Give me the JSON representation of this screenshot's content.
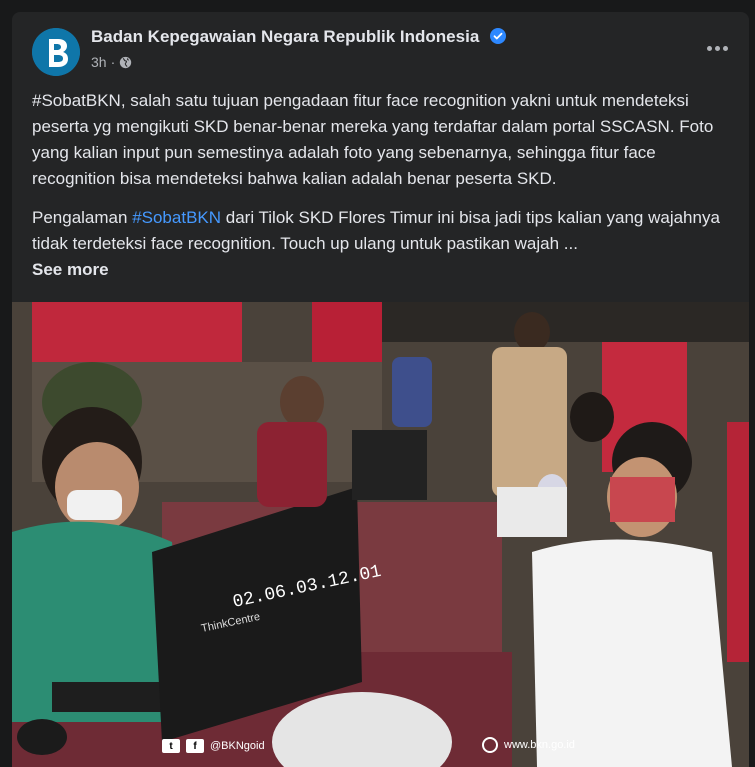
{
  "post": {
    "page_name": "Badan Kepegawaian Negara Republik Indonesia",
    "time": "3h",
    "separator": "·",
    "paragraph1": "#SobatBKN, salah satu tujuan pengadaan fitur face recognition yakni untuk mendeteksi peserta yg mengikuti SKD benar-benar mereka yang terdaftar dalam portal SSCASN. Foto yang kalian input pun semestinya adalah foto yang sebenarnya, sehingga fitur face recognition bisa mendeteksi bahwa kalian adalah benar peserta SKD.",
    "paragraph2_pre": "Pengalaman ",
    "paragraph2_hashtag": "#SobatBKN",
    "paragraph2_post": " dari Tilok SKD Flores Timur ini bisa jadi tips kalian yang wajahnya tidak terdeteksi face recognition. Touch up ulang untuk pastikan wajah ...",
    "see_more": "See more"
  },
  "photo": {
    "monitor_brand": "ThinkCentre",
    "monitor_clock": "02.06.03.12.01",
    "watermark_handle": "@BKNgoid",
    "watermark_site": "www.bkn.go.id"
  },
  "icons": {
    "verified": "verified-badge-icon",
    "privacy": "globe-icon",
    "more": "more-options-icon"
  },
  "colors": {
    "background": "#18191a",
    "card": "#242526",
    "text": "#e4e6eb",
    "secondary_text": "#b0b3b8",
    "link": "#4599ff",
    "verified": "#2d88ff"
  }
}
